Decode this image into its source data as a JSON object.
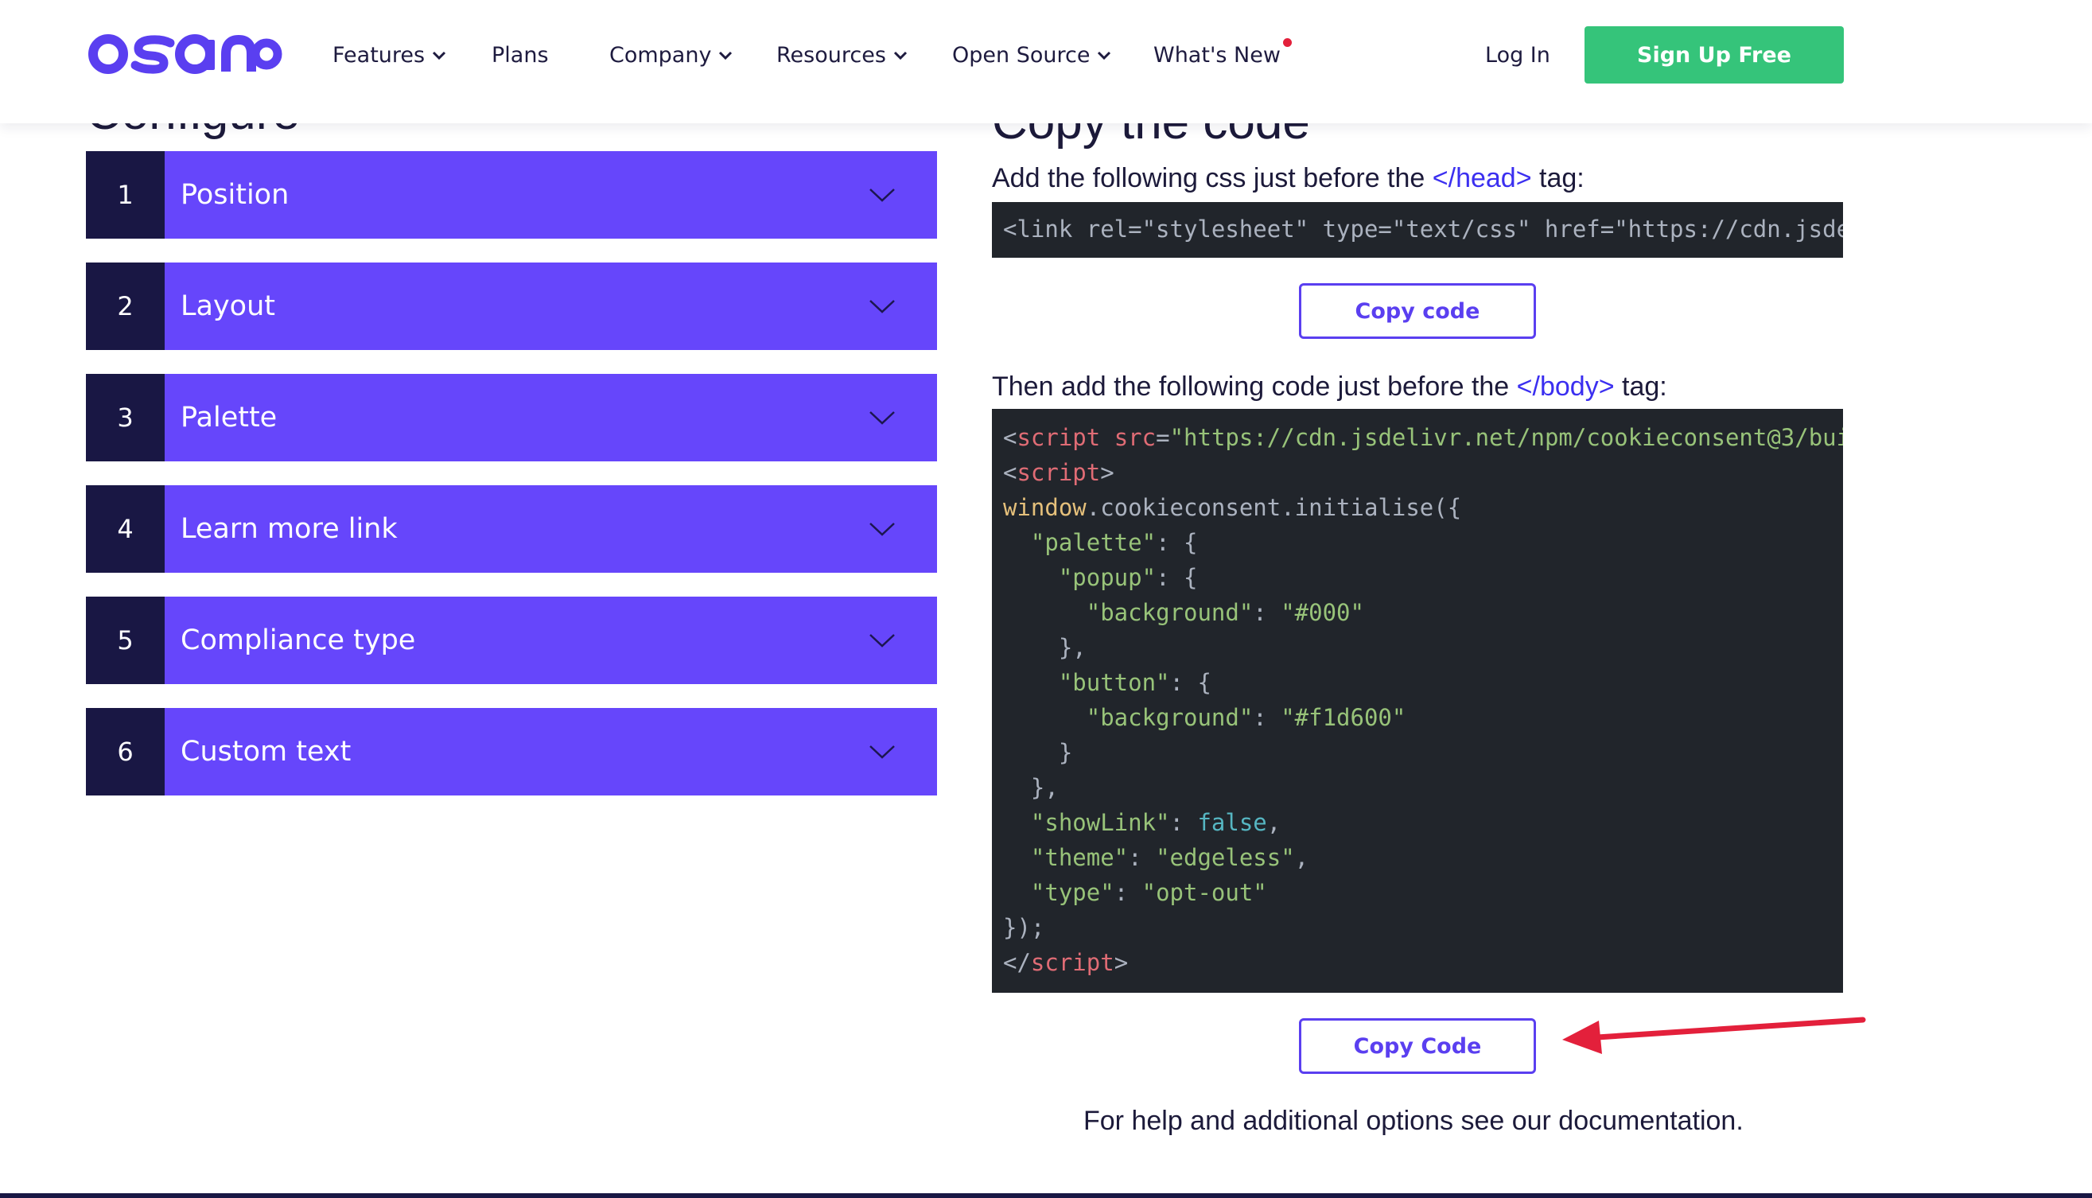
{
  "header": {
    "logo_text": "osano",
    "nav": [
      {
        "label": "Features",
        "has_dropdown": true
      },
      {
        "label": "Plans",
        "has_dropdown": false
      },
      {
        "label": "Company",
        "has_dropdown": true
      },
      {
        "label": "Resources",
        "has_dropdown": true
      },
      {
        "label": "Open Source",
        "has_dropdown": true
      },
      {
        "label": "What's New",
        "has_dropdown": false,
        "indicator": "red-dot"
      }
    ],
    "login_label": "Log In",
    "signup_label": "Sign Up Free"
  },
  "configure": {
    "heading": "Configure",
    "steps": [
      {
        "number": "1",
        "label": "Position"
      },
      {
        "number": "2",
        "label": "Layout"
      },
      {
        "number": "3",
        "label": "Palette"
      },
      {
        "number": "4",
        "label": "Learn more link"
      },
      {
        "number": "5",
        "label": "Compliance type"
      },
      {
        "number": "6",
        "label": "Custom text"
      }
    ]
  },
  "copy": {
    "heading": "Copy the code",
    "css_instruction": {
      "before": "Add the following css just before the ",
      "tag": "</head>",
      "after": " tag:"
    },
    "css_code": "<link rel=\"stylesheet\" type=\"text/css\" href=\"https://cdn.jsde",
    "css_copy_label": "Copy code",
    "body_instruction": {
      "before": "Then add the following code just before the ",
      "tag": "</body>",
      "after": " tag:"
    },
    "js_copy_label": "Copy Code",
    "help_text": "For help and additional options see our documentation."
  },
  "colors": {
    "brand_purple": "#6646fb",
    "step_number_bg": "#191744",
    "signup_green": "#35c47a",
    "code_bg": "#21252b",
    "annotation_arrow": "#e3203b"
  }
}
